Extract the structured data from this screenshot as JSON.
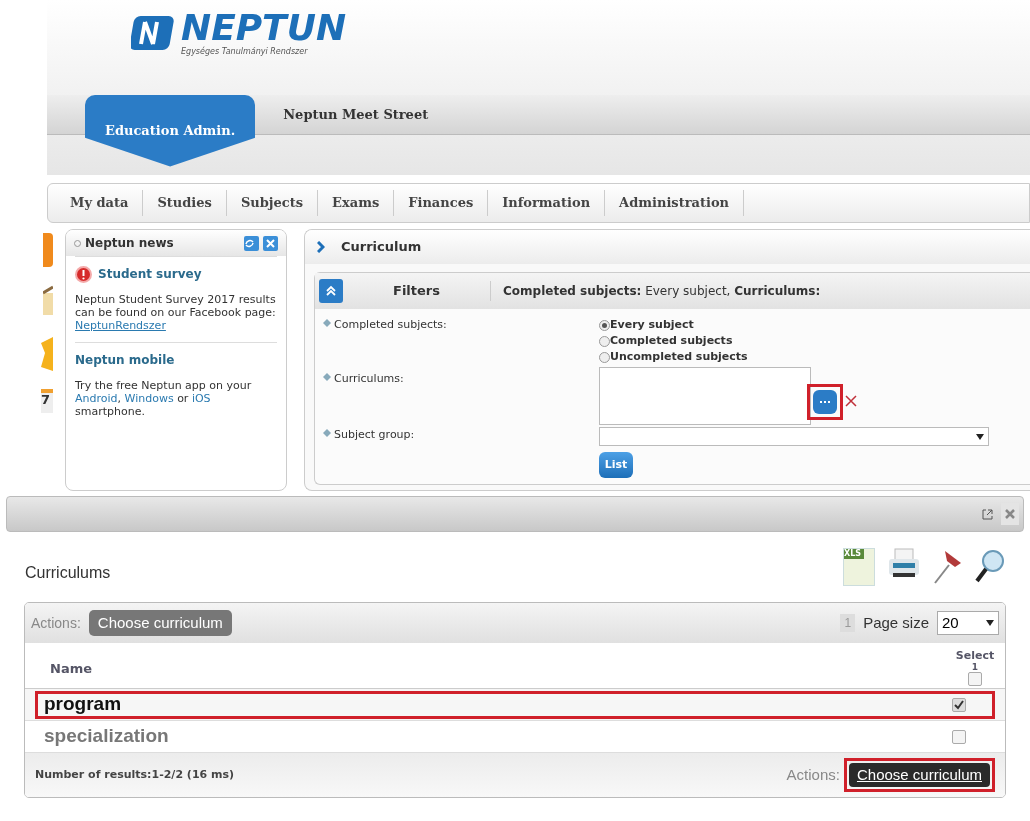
{
  "logo": {
    "name": "NEPTUN",
    "tagline": "Egységes Tanulmányi Rendszer"
  },
  "top_tabs": [
    {
      "label": "Education Admin.",
      "selected": true
    },
    {
      "label": "Neptun Meet Street",
      "selected": false
    }
  ],
  "menu": [
    "My data",
    "Studies",
    "Subjects",
    "Exams",
    "Finances",
    "Information",
    "Administration"
  ],
  "side_icons": {
    "calendar_day": "7"
  },
  "news": {
    "title": "Neptun news",
    "items": [
      {
        "title": "Student survey",
        "alert": true,
        "parts": [
          {
            "text": "Neptun Student Survey 2017 results can be found on our Facebook page: ",
            "link": false
          },
          {
            "text": "NeptunRendszer",
            "link": true
          }
        ]
      },
      {
        "title": "Neptun mobile",
        "alert": false,
        "parts": [
          {
            "text": "Try the free Neptun app on your ",
            "link": false
          },
          {
            "text": "Android",
            "link": true
          },
          {
            "text": ", ",
            "link": false
          },
          {
            "text": "Windows",
            "link": true
          },
          {
            "text": " or ",
            "link": false
          },
          {
            "text": "iOS",
            "link": true
          },
          {
            "text": " smartphone.",
            "link": false
          }
        ]
      }
    ]
  },
  "curriculum": {
    "title": "Curriculum",
    "filters_label": "Filters",
    "summary": "**Completed subjects:** Every subject, **Curriculums:**",
    "completed_label": "Completed subjects:",
    "radios": [
      {
        "label": "Every subject",
        "selected": true
      },
      {
        "label": "Completed subjects",
        "selected": false
      },
      {
        "label": "Uncompleted subjects",
        "selected": false
      }
    ],
    "curriculums_label": "Curriculums:",
    "picker_highlighted": true,
    "subject_group_label": "Subject group:",
    "list_button": "List"
  },
  "modal": {
    "title": "Curriculums",
    "xls_label": "XLS",
    "actions_label": "Actions:",
    "choose_button": "Choose curriculum",
    "page_number": "1",
    "page_size_label": "Page size",
    "page_size": "20",
    "col_name": "Name",
    "col_select": "Select",
    "col_select_count": "1",
    "select_all_checked": false,
    "rows": [
      {
        "name": "program",
        "checked": true,
        "highlighted": true
      },
      {
        "name": "specialization",
        "checked": false,
        "highlighted": false
      }
    ],
    "results": "Number of results:1-2/2 (16 ms)",
    "footer_actions_label": "Actions:",
    "footer_button": "Choose curriculum",
    "footer_button_highlighted": true
  }
}
